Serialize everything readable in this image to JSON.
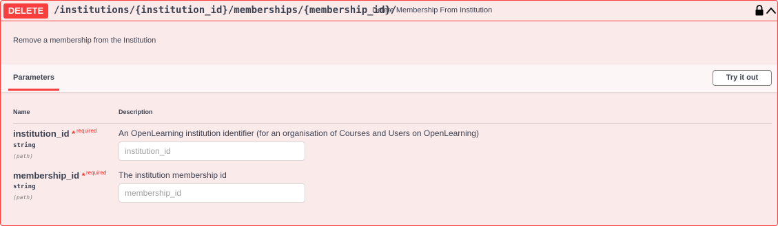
{
  "operation": {
    "method": "DELETE",
    "path": "/institutions/{institution_id}/memberships/{membership_id}/",
    "summary": "Delete Membership From Institution",
    "description": "Remove a membership from the Institution",
    "method_color": "#f93e3e",
    "background_color": "#fbeaea"
  },
  "header_icons": [
    "lock-icon",
    "chevron-up-icon"
  ],
  "parameters_section": {
    "tab_label": "Parameters",
    "try_button": "Try it out",
    "columns": {
      "name": "Name",
      "description": "Description"
    }
  },
  "parameters": [
    {
      "name": "institution_id",
      "star": "*",
      "required_label": "required",
      "type": "string",
      "in": "(path)",
      "description": "An OpenLearning institution identifier (for an organisation of Courses and Users on OpenLearning)",
      "placeholder": "institution_id",
      "value": ""
    },
    {
      "name": "membership_id",
      "star": "*",
      "required_label": "required",
      "type": "string",
      "in": "(path)",
      "description": "The institution membership id",
      "placeholder": "membership_id",
      "value": ""
    }
  ]
}
